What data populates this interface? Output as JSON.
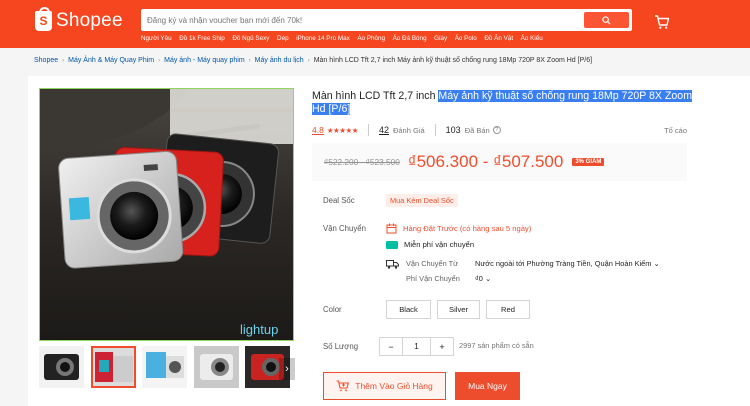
{
  "header": {
    "logo_text": "Shopee",
    "logo_letter": "S",
    "search_placeholder": "Đăng ký và nhận voucher bạn mới đến 70k!",
    "suggestions": [
      "Người Yêu",
      "Đồ 1k Free Ship",
      "Đồ Ngủ Sexy",
      "Dép",
      "iPhone 14 Pro Max",
      "Áo Phông",
      "Áo Đá Bóng",
      "Giày",
      "Áo Polo",
      "Đồ Ăn Vặt",
      "Áo Kiểu"
    ],
    "brand_color": "#f5461f"
  },
  "breadcrumb": {
    "items": [
      "Shopee",
      "Máy Ảnh & Máy Quay Phim",
      "Máy ảnh - Máy quay phim",
      "Máy ảnh du lịch"
    ],
    "current": "Màn hình LCD Tft 2,7 inch Máy ảnh kỹ thuật số chống rung 18Mp 720P 8X Zoom Hd [P/6]"
  },
  "product": {
    "title_plain": "Màn hình LCD Tft 2,7 inch ",
    "title_selected": "Máy ảnh kỹ thuật số chống rung 18Mp 720P 8X Zoom Hd [P/6]",
    "image_watermark": "lightup",
    "rating": "4.8",
    "stars": "★★★★★",
    "reviews_count": "42",
    "reviews_label": "Đánh Giá",
    "sold_count": "103",
    "sold_label": "Đã Bán",
    "report_label": "Tố cáo",
    "old_price": "₫522.200 - ₫523.500",
    "new_price": "₫506.300 - ₫507.500",
    "discount": "3% GIẢM"
  },
  "deal": {
    "label": "Deal Sốc",
    "badge": "Mua Kèm Deal Sốc"
  },
  "shipping": {
    "label": "Vận Chuyển",
    "preorder": "Hàng Đặt Trước (có hàng sau 5 ngày)",
    "free_ship": "Miễn phí vận chuyển",
    "from_label": "Vận Chuyển Từ",
    "from_value": "Nước ngoài tới Phường Tràng Tiền, Quận Hoàn Kiếm",
    "fee_label": "Phí Vận Chuyển",
    "fee_value": "₫0"
  },
  "color": {
    "label": "Color",
    "options": [
      "Black",
      "Silver",
      "Red"
    ]
  },
  "quantity": {
    "label": "Số Lượng",
    "minus": "−",
    "value": "1",
    "plus": "+",
    "stock": "2997 sản phẩm có sẵn"
  },
  "actions": {
    "add_to_cart": "Thêm Vào Giỏ Hàng",
    "buy_now": "Mua Ngay"
  },
  "thumbs_next": "›"
}
